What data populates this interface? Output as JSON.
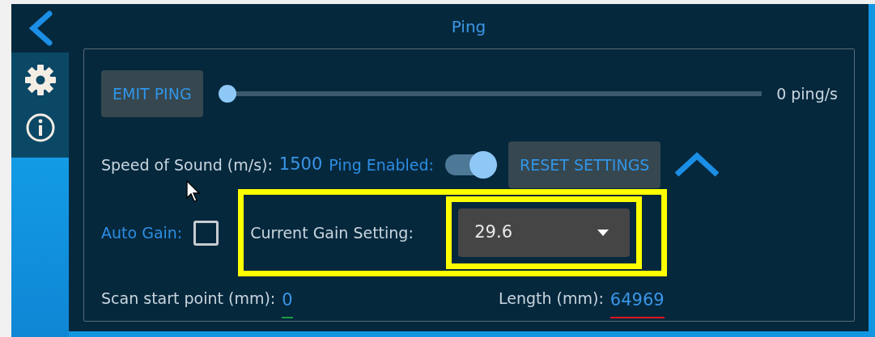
{
  "window": {
    "title": "Ping"
  },
  "sidebar": {
    "items": [
      {
        "kind": "settings"
      },
      {
        "kind": "info"
      }
    ]
  },
  "emit_button": {
    "label": "EMIT PING"
  },
  "rate_slider": {
    "level": 0,
    "reading": "0 ping/s"
  },
  "speed_of_sound": {
    "label": "Speed of Sound (m/s):",
    "value": "1500"
  },
  "ping_enabled": {
    "label": "Ping Enabled:",
    "on": true
  },
  "reset_button": {
    "label": "RESET SETTINGS"
  },
  "collapse": {
    "expanded": true
  },
  "auto_gain": {
    "label": "Auto Gain:",
    "checked": false
  },
  "gain": {
    "label": "Current Gain Setting:",
    "value": "29.6",
    "highlighted": true
  },
  "readouts": [
    {
      "label": "Scan start point (mm):",
      "value": "0",
      "color": "#1f9a3a"
    },
    {
      "label": "Length (mm):",
      "value": "64969",
      "color": "#e0141e"
    }
  ]
}
